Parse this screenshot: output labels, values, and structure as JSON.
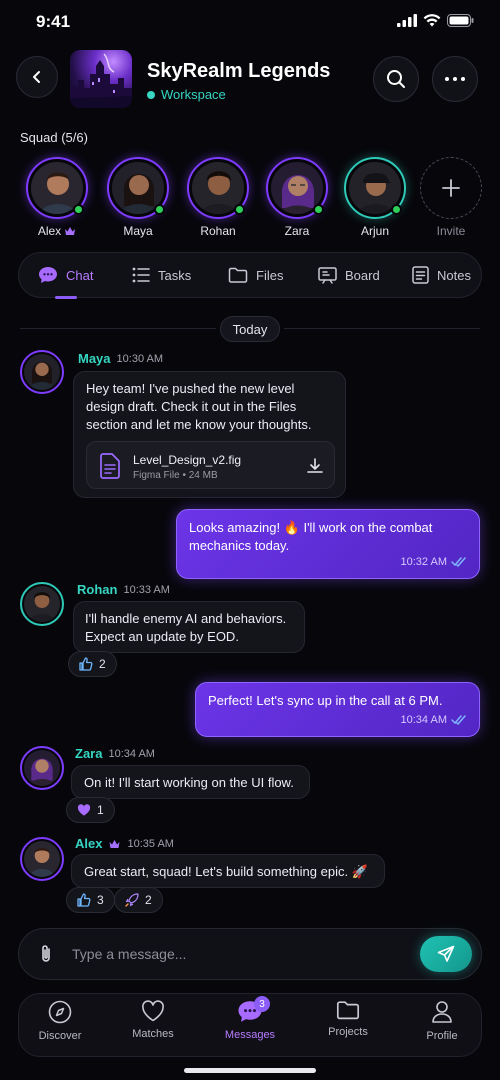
{
  "status": {
    "time": "9:41"
  },
  "header": {
    "title": "SkyRealm Legends",
    "subtitle": "Workspace"
  },
  "squad": {
    "label": "Squad (5/6)",
    "members": [
      {
        "name": "Alex",
        "ring": "#7d3cff",
        "crown": true
      },
      {
        "name": "Maya",
        "ring": "#7d3cff"
      },
      {
        "name": "Rohan",
        "ring": "#7d3cff"
      },
      {
        "name": "Zara",
        "ring": "#7d3cff"
      },
      {
        "name": "Arjun",
        "ring": "#2fc9b8"
      }
    ],
    "invite_label": "Invite"
  },
  "tabs": [
    {
      "label": "Chat",
      "icon": "chat-icon",
      "active": true
    },
    {
      "label": "Tasks",
      "icon": "list-icon"
    },
    {
      "label": "Files",
      "icon": "folder-icon"
    },
    {
      "label": "Board",
      "icon": "board-icon"
    },
    {
      "label": "Notes",
      "icon": "note-icon"
    }
  ],
  "date_divider": "Today",
  "messages": {
    "m1": {
      "author": "Maya",
      "time": "10:30 AM",
      "text": "Hey team! I've pushed the new level design draft. Check it out in the Files section and let me know your thoughts.",
      "file": {
        "name": "Level_Design_v2.fig",
        "meta": "Figma File • 24 MB"
      }
    },
    "m2": {
      "text": "Looks amazing! 🔥 I'll work on the combat mechanics today.",
      "time": "10:32 AM"
    },
    "m3": {
      "author": "Rohan",
      "time": "10:33 AM",
      "text": "I'll handle enemy AI and behaviors. Expect an update by EOD.",
      "reaction": {
        "icon": "thumbs-up-icon",
        "count": "2"
      }
    },
    "m4": {
      "text": "Perfect! Let's sync up in the call at 6 PM.",
      "time": "10:34 AM"
    },
    "m5": {
      "author": "Zara",
      "time": "10:34 AM",
      "text": "On it! I'll start working on the UI flow.",
      "reaction": {
        "icon": "heart-icon",
        "count": "1"
      }
    },
    "m6": {
      "author": "Alex",
      "time": "10:35 AM",
      "text": "Great start, squad! Let's build something epic. 🚀",
      "reactions": [
        {
          "icon": "thumbs-up-icon",
          "count": "3"
        },
        {
          "icon": "rocket-icon",
          "count": "2"
        }
      ]
    }
  },
  "composer": {
    "placeholder": "Type a message..."
  },
  "bottom_nav": [
    {
      "label": "Discover",
      "icon": "compass-icon"
    },
    {
      "label": "Matches",
      "icon": "heart-icon"
    },
    {
      "label": "Messages",
      "icon": "chat-icon",
      "active": true,
      "badge": "3"
    },
    {
      "label": "Projects",
      "icon": "folder-icon"
    },
    {
      "label": "Profile",
      "icon": "person-icon"
    }
  ],
  "colors": {
    "accent": "#8b5cf6",
    "teal": "#36d6c3",
    "online": "#2fd05a",
    "background": "#07070b"
  }
}
